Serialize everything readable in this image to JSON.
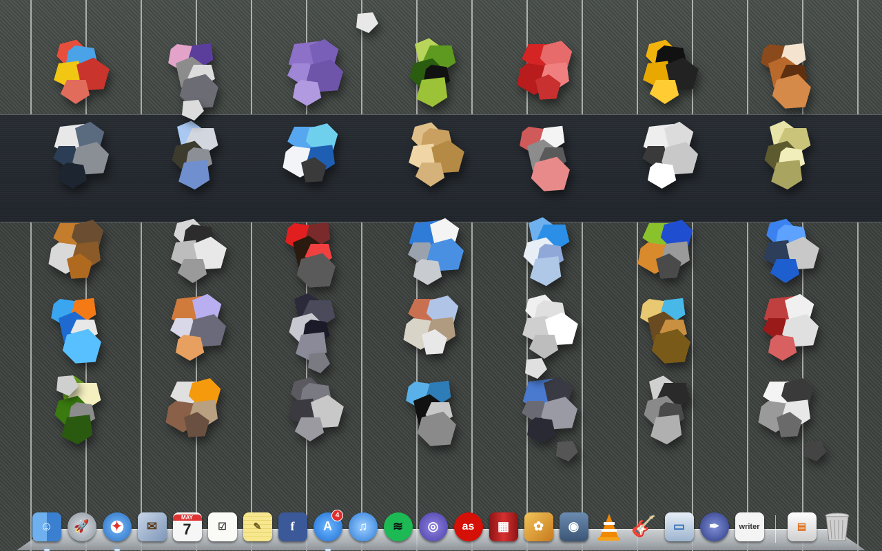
{
  "desktop": {
    "rows": [
      [
        "launchpad-shards-1",
        "launchpad-shards-2",
        "launchpad-shards-3",
        "launchpad-shards-4",
        "launchpad-shards-5",
        "launchpad-shards-6",
        "launchpad-shards-7"
      ],
      [
        "launchpad-shards-8",
        "launchpad-shards-9",
        "launchpad-shards-10",
        "launchpad-shards-11",
        "launchpad-shards-12",
        "launchpad-shards-13",
        "launchpad-shards-14"
      ],
      [
        "launchpad-shards-15",
        "launchpad-shards-16",
        "launchpad-shards-17",
        "launchpad-shards-18",
        "launchpad-shards-19",
        "launchpad-shards-20",
        "launchpad-shards-21"
      ],
      [
        "launchpad-shards-22",
        "launchpad-shards-23",
        "launchpad-shards-24",
        "launchpad-shards-25",
        "launchpad-shards-26",
        "launchpad-shards-27",
        "launchpad-shards-28"
      ],
      [
        "launchpad-shards-29",
        "launchpad-shards-30",
        "launchpad-shards-31",
        "launchpad-shards-32",
        "launchpad-shards-33",
        "launchpad-shards-34",
        "launchpad-shards-35"
      ]
    ]
  },
  "dock": {
    "calendar_month": "MAY",
    "calendar_day": "7",
    "facebook_label": "f",
    "appstore_badge": "4",
    "lastfm_label": "as",
    "writer_label": "writer",
    "items": [
      {
        "name": "finder-icon",
        "color": "#4a8fd8"
      },
      {
        "name": "launchpad-icon",
        "color": "#9aa3ad"
      },
      {
        "name": "safari-icon",
        "color": "#3f8de0"
      },
      {
        "name": "mail-icon",
        "color": "#6f8fb8"
      },
      {
        "name": "calendar-icon",
        "color": "#f2f2f2"
      },
      {
        "name": "reminders-icon",
        "color": "#f7f7f4"
      },
      {
        "name": "notes-icon",
        "color": "#f5e38a"
      },
      {
        "name": "facebook-icon",
        "color": "#3b5998"
      },
      {
        "name": "app-store-icon",
        "color": "#2f8cea"
      },
      {
        "name": "itunes-icon",
        "color": "#3c8fe6"
      },
      {
        "name": "spotify-icon",
        "color": "#1db954"
      },
      {
        "name": "bittorrent-icon",
        "color": "#6a5cc4"
      },
      {
        "name": "lastfm-icon",
        "color": "#d51007"
      },
      {
        "name": "photo-booth-icon",
        "color": "#b01e1e"
      },
      {
        "name": "iphoto-icon",
        "color": "#d08a2c"
      },
      {
        "name": "image-capture-icon",
        "color": "#4e6d8f"
      },
      {
        "name": "vlc-icon",
        "color": "#f08a00"
      },
      {
        "name": "garageband-icon",
        "color": "#b4742f"
      },
      {
        "name": "keynote-icon",
        "color": "#2f6fb8"
      },
      {
        "name": "preview-icon",
        "color": "#3d4d9e"
      },
      {
        "name": "writer-icon",
        "color": "#f4f4f4"
      },
      {
        "name": "documents-stack-icon",
        "color": "#d9d9d9"
      },
      {
        "name": "trash-icon",
        "color": "#c9c9c9"
      }
    ]
  }
}
